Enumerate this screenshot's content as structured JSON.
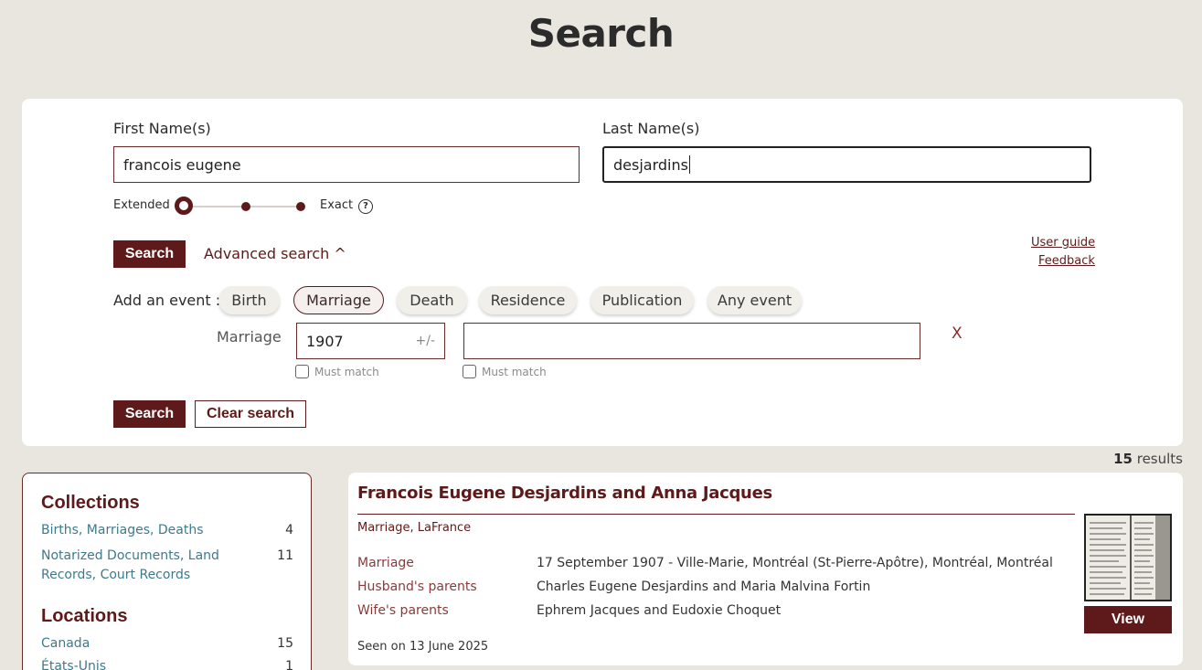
{
  "page": {
    "title": "Search"
  },
  "search": {
    "first_name_label": "First Name(s)",
    "first_name_value": "francois eugene",
    "last_name_label": "Last Name(s)",
    "last_name_value": "desjardins",
    "slider": {
      "left_label": "Extended",
      "right_label": "Exact",
      "help_icon": "?",
      "positions": 3,
      "selected_index": 0
    },
    "search_button": "Search",
    "advanced_link": "Advanced search ^",
    "user_guide_link": "User guide",
    "feedback_link": "Feedback",
    "add_event_label": "Add an event :",
    "event_chips": [
      {
        "label": "Birth",
        "active": false
      },
      {
        "label": "Marriage",
        "active": true
      },
      {
        "label": "Death",
        "active": false
      },
      {
        "label": "Residence",
        "active": false
      },
      {
        "label": "Publication",
        "active": false
      },
      {
        "label": "Any event",
        "active": false
      }
    ],
    "event_row": {
      "label": "Marriage",
      "year_value": "1907",
      "year_range_symbol": "+/-",
      "place_value": "",
      "remove_label": "X",
      "must_match_label": "Must match"
    },
    "bottom_search_button": "Search",
    "clear_button": "Clear search"
  },
  "results": {
    "count": "15",
    "count_suffix": "results"
  },
  "facets": {
    "collections_heading": "Collections",
    "collections": [
      {
        "name": "Births, Marriages, Deaths",
        "count": "4"
      },
      {
        "name": "Notarized Documents, Land Records, Court Records",
        "count": "11"
      }
    ],
    "locations_heading": "Locations",
    "locations": [
      {
        "name": "Canada",
        "count": "15"
      },
      {
        "name": "États-Unis",
        "count": "1"
      }
    ]
  },
  "result": {
    "title": "Francois Eugene Desjardins and Anna Jacques",
    "subtitle": "Marriage, LaFrance",
    "rows": [
      {
        "label": "Marriage",
        "value": "17 September 1907 - Ville-Marie, Montréal (St-Pierre-Apôtre), Montréal, Montréal"
      },
      {
        "label": "Husband's parents",
        "value": "Charles Eugene Desjardins and Maria Malvina Fortin"
      },
      {
        "label": "Wife's parents",
        "value": "Ephrem Jacques and Eudoxie Choquet"
      }
    ],
    "seen": "Seen on 13 June 2025",
    "view_button": "View"
  },
  "colors": {
    "accent": "#5e1a1a",
    "background": "#e9e6df",
    "link_teal": "#3d7a8c"
  }
}
